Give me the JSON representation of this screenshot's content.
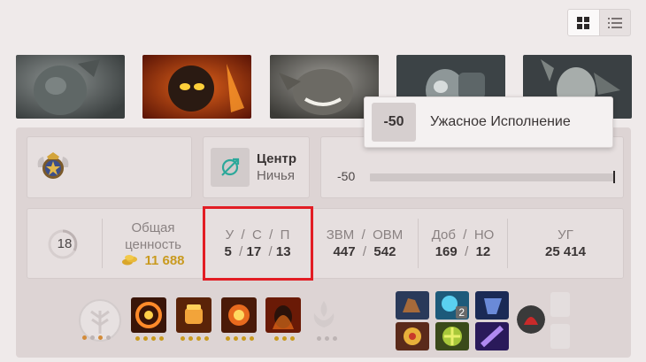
{
  "view_toggle": {
    "grid_icon": "grid-icon",
    "list_icon": "list-icon",
    "active": "grid"
  },
  "heroes": [
    {
      "name": "hero-portrait-1"
    },
    {
      "name": "hero-portrait-2"
    },
    {
      "name": "hero-portrait-3"
    },
    {
      "name": "hero-portrait-4"
    },
    {
      "name": "hero-portrait-5"
    }
  ],
  "lane": {
    "title": "Центр",
    "subtitle": "Ничья",
    "icon": "lane-target-icon"
  },
  "score": {
    "value": "-50",
    "fraction": 0.0
  },
  "tooltip": {
    "badge": "-50",
    "text": "Ужасное Исполнение"
  },
  "stats": {
    "level": "18",
    "net_worth_label_1": "Общая",
    "net_worth_label_2": "ценность",
    "net_worth": "11 688",
    "kda_label": {
      "k": "У",
      "d": "С",
      "a": "П",
      "sep": "/"
    },
    "kda": {
      "k": "5",
      "d": "17",
      "a": "13"
    },
    "xpm_label": "ЗВМ",
    "gpm_label": "ОВМ",
    "xpm": "447",
    "gpm": "542",
    "lh_label": "Доб",
    "dn_label": "НО",
    "lh": "169",
    "dn": "12",
    "dmg_label": "УГ",
    "dmg": "25 414"
  },
  "backpack_badge": "2",
  "colors": {
    "highlight": "#e21d24",
    "gold": "#c99a1f",
    "panel": "#ddd4d4"
  }
}
